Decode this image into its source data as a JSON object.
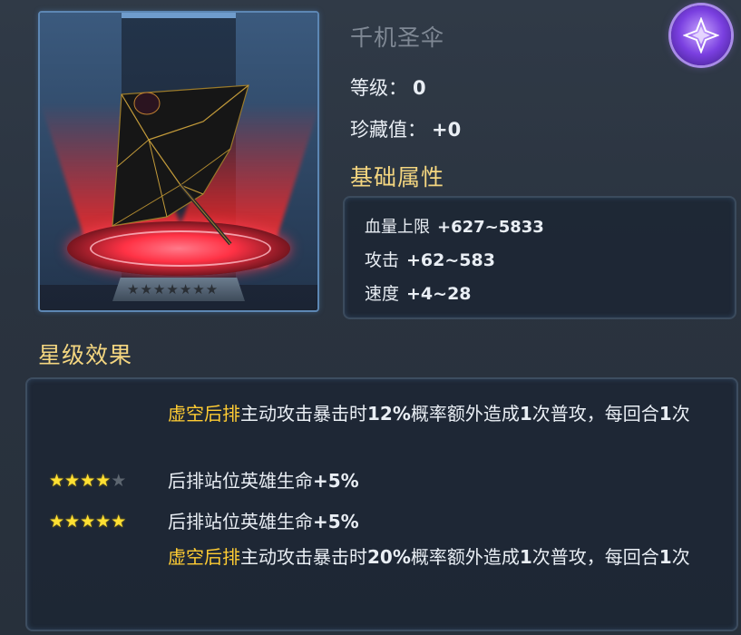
{
  "item": {
    "name": "千机圣伞",
    "level_label": "等级：",
    "level_value": "0",
    "collect_label": "珍藏值：",
    "collect_value": "+0",
    "showcase_stars": 0,
    "showcase_stars_max": 7
  },
  "base_attributes": {
    "title": "基础属性",
    "rows": [
      {
        "label": "血量上限",
        "value": "+627~5833"
      },
      {
        "label": "攻击",
        "value": "+62~583"
      },
      {
        "label": "速度",
        "value": "+4~28"
      }
    ]
  },
  "star_effects": {
    "title": "星级效果",
    "effects": [
      {
        "highlight": "虚空后排",
        "text_a": "主动攻击暴击时",
        "bold": "12%",
        "text_b": "概率额外造成",
        "bold2": "1",
        "text_c": "次普攻，每回合",
        "bold3": "1",
        "text_d": "次",
        "stars": null
      },
      {
        "text": "后排站位英雄生命",
        "bold": "+5%",
        "stars": 4,
        "stars_max": 5
      },
      {
        "text": "后排站位英雄生命",
        "bold": "+5%",
        "stars": 5,
        "stars_max": 5
      },
      {
        "highlight": "虚空后排",
        "text_a": "主动攻击暴击时",
        "bold": "20%",
        "text_b": "概率额外造成",
        "bold2": "1",
        "text_c": "次普攻，每回合",
        "bold3": "1",
        "text_d": "次",
        "stars": null
      }
    ]
  },
  "colors": {
    "highlight": "#ffcc33",
    "section_title": "#f4d680",
    "star_on": "#ffe033",
    "orb": "#7a3fe0"
  },
  "icons": {
    "orb": "crystal-emblem-icon",
    "star": "star-icon"
  }
}
